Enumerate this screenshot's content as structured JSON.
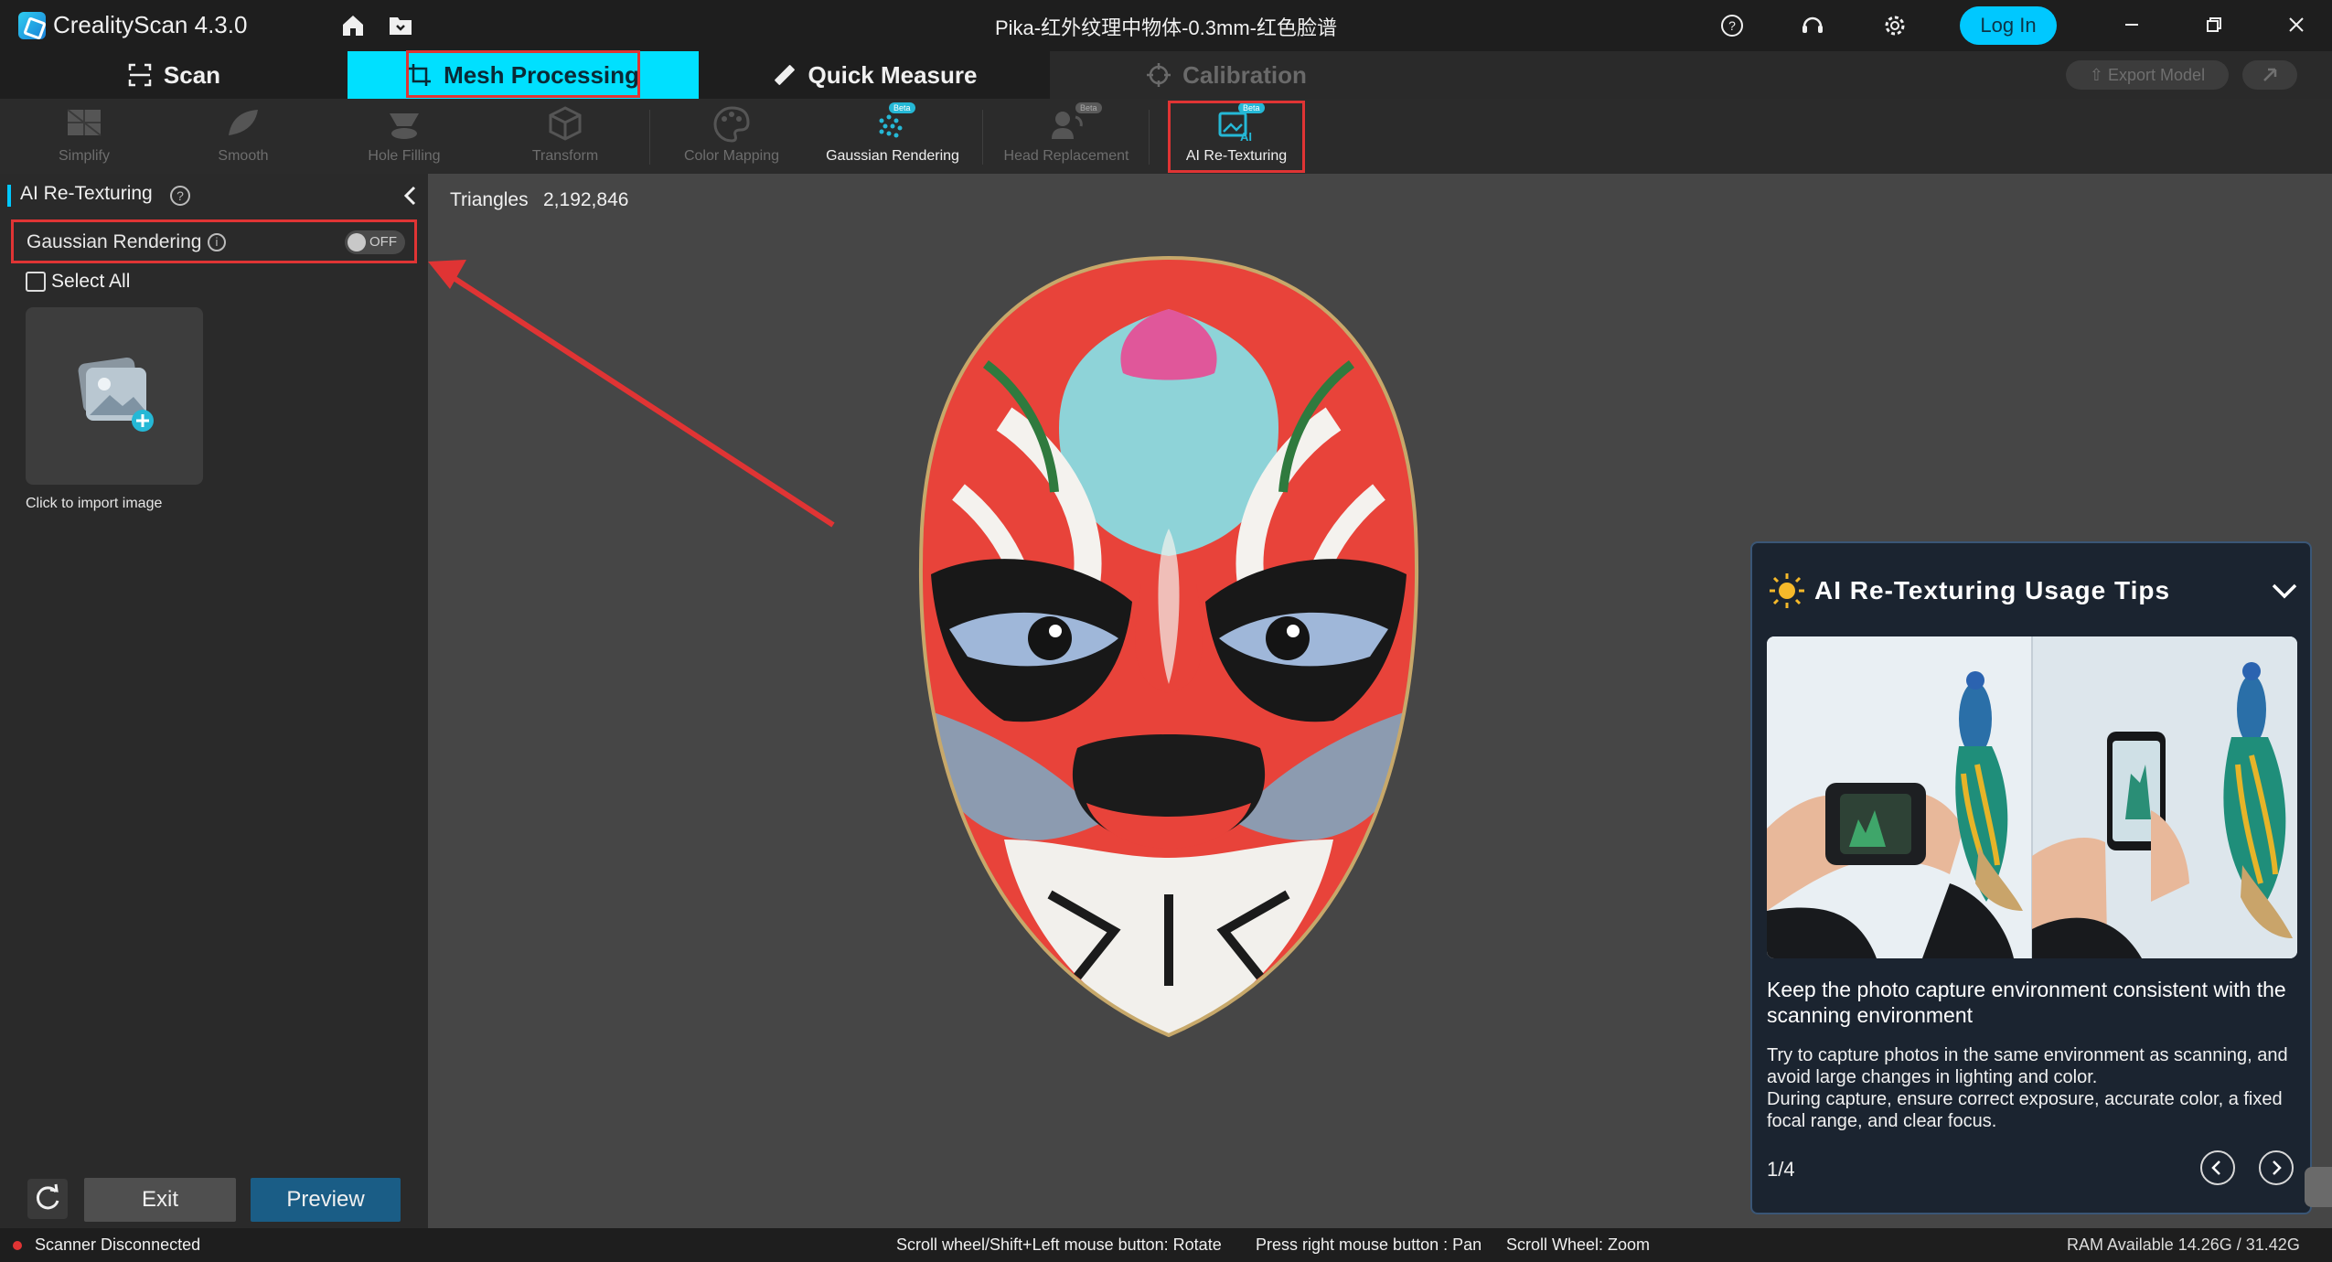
{
  "titlebar": {
    "app_name": "CrealityScan 4.3.0",
    "document_title": "Pika-红外纹理中物体-0.3mm-红色脸谱",
    "login_label": "Log In",
    "icons": [
      "home-icon",
      "folder-icon",
      "help-icon",
      "support-icon",
      "settings-icon",
      "minimize-icon",
      "restore-icon",
      "close-icon"
    ]
  },
  "tabs": {
    "scan": "Scan",
    "mesh_processing": "Mesh Processing",
    "quick_measure": "Quick Measure",
    "calibration": "Calibration",
    "export_model": "Export Model"
  },
  "toolbar": {
    "items": [
      {
        "label": "Simplify",
        "enabled": false
      },
      {
        "label": "Smooth",
        "enabled": false
      },
      {
        "label": "Hole Filling",
        "enabled": false
      },
      {
        "label": "Transform",
        "enabled": false
      },
      {
        "label": "Color Mapping",
        "enabled": false
      },
      {
        "label": "Gaussian Rendering",
        "enabled": true,
        "badge": "Beta"
      },
      {
        "label": "Head Replacement",
        "enabled": false,
        "badge": "Beta"
      },
      {
        "label": "AI Re-Texturing",
        "enabled": true,
        "badge": "Beta"
      }
    ]
  },
  "left_panel": {
    "title": "AI Re-Texturing",
    "gaussian_label": "Gaussian Rendering",
    "toggle_state": "OFF",
    "select_all": "Select All",
    "import_label": "Click to import image",
    "exit_label": "Exit",
    "preview_label": "Preview"
  },
  "viewport": {
    "triangles_label": "Triangles",
    "triangles_value": "2,192,846"
  },
  "tips": {
    "title": "AI Re-Texturing Usage Tips",
    "heading": "Keep the photo capture environment consistent with the scanning environment",
    "body_1": "Try to capture photos in the same environment as scanning, and avoid large changes in lighting and color.",
    "body_2": "During capture, ensure correct exposure, accurate color, a fixed focal range, and clear focus.",
    "page": "1/4"
  },
  "statusbar": {
    "scanner_status": "Scanner Disconnected",
    "hint_rotate": "Scroll wheel/Shift+Left mouse button: Rotate",
    "hint_pan": "Press right mouse button : Pan",
    "hint_zoom": "Scroll Wheel: Zoom",
    "ram": "RAM Available 14.26G / 31.42G"
  },
  "colors": {
    "accent": "#00e0ff",
    "highlight": "#e03434",
    "login": "#00c8ff",
    "preview": "#1a5d86"
  }
}
